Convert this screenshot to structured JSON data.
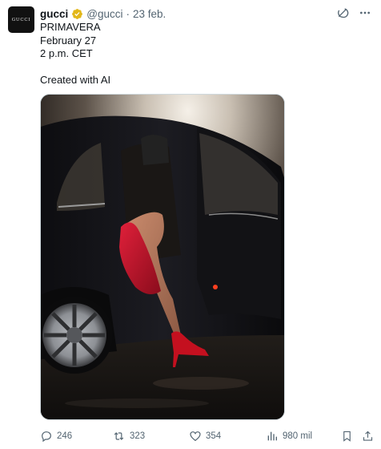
{
  "account": {
    "avatar_text": "GUCCI",
    "name": "gucci",
    "handle": "@gucci",
    "separator": "·",
    "date": "23 feb."
  },
  "post": {
    "lines": [
      "PRIMAVERA",
      "February 27",
      "2 p.m. CET"
    ],
    "disclaimer": "Created with AI"
  },
  "icons": {
    "verified": "verified-gold-badge-icon",
    "grok": "grok-icon",
    "more": "more-options-icon"
  },
  "actions": {
    "replies": "246",
    "reposts": "323",
    "likes": "354",
    "views": "980 mil"
  },
  "colors": {
    "verified_gold": "#e2b719",
    "muted_text": "#536471",
    "text": "#0f1419"
  }
}
